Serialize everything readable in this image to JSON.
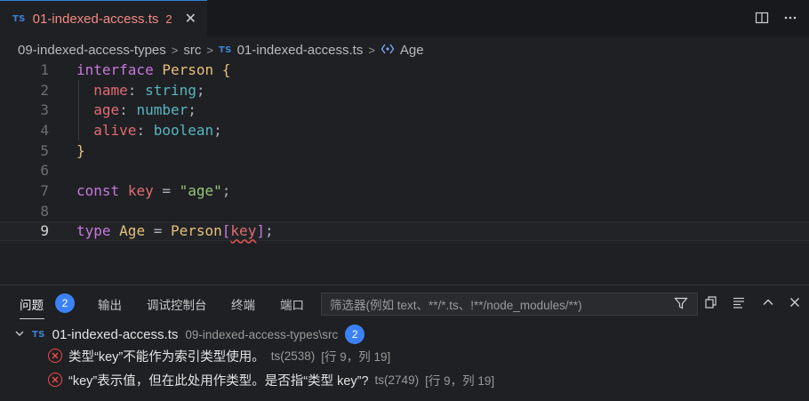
{
  "tab": {
    "lang_badge": "TS",
    "title": "01-indexed-access.ts",
    "problem_count": "2",
    "close_glyph": "✕"
  },
  "tab_actions": {
    "split_icon": "split-editor-icon",
    "more_icon": "more-actions-icon"
  },
  "breadcrumb": {
    "folder": "09-indexed-access-types",
    "subfolder": "src",
    "file_badge": "TS",
    "file": "01-indexed-access.ts",
    "symbol": "Age",
    "sep": ">"
  },
  "editor": {
    "line_numbers": [
      "1",
      "2",
      "3",
      "4",
      "5",
      "6",
      "7",
      "8",
      "9"
    ],
    "current_line": "9",
    "lines": [
      [
        {
          "t": "interface",
          "c": "kw"
        },
        {
          "t": " "
        },
        {
          "t": "Person",
          "c": "ty"
        },
        {
          "t": " "
        },
        {
          "t": "{",
          "c": "brace"
        }
      ],
      [
        {
          "t": "  "
        },
        {
          "t": "name",
          "c": "prop"
        },
        {
          "t": ": ",
          "c": "punc"
        },
        {
          "t": "string",
          "c": "tstr"
        },
        {
          "t": ";",
          "c": "punc"
        }
      ],
      [
        {
          "t": "  "
        },
        {
          "t": "age",
          "c": "prop"
        },
        {
          "t": ": ",
          "c": "punc"
        },
        {
          "t": "number",
          "c": "tstr"
        },
        {
          "t": ";",
          "c": "punc"
        }
      ],
      [
        {
          "t": "  "
        },
        {
          "t": "alive",
          "c": "prop"
        },
        {
          "t": ": ",
          "c": "punc"
        },
        {
          "t": "boolean",
          "c": "tstr"
        },
        {
          "t": ";",
          "c": "punc"
        }
      ],
      [
        {
          "t": "}",
          "c": "brace"
        }
      ],
      [],
      [
        {
          "t": "const",
          "c": "kw"
        },
        {
          "t": " "
        },
        {
          "t": "key",
          "c": "prop"
        },
        {
          "t": " = ",
          "c": "punc"
        },
        {
          "t": "\"age\"",
          "c": "str"
        },
        {
          "t": ";",
          "c": "punc"
        }
      ],
      [],
      [
        {
          "t": "type",
          "c": "kw"
        },
        {
          "t": " "
        },
        {
          "t": "Age",
          "c": "ty"
        },
        {
          "t": " = ",
          "c": "punc"
        },
        {
          "t": "Person",
          "c": "ty"
        },
        {
          "t": "[",
          "c": "brk"
        },
        {
          "t": "key",
          "c": "prop squig"
        },
        {
          "t": "]",
          "c": "brk"
        },
        {
          "t": ";",
          "c": "punc"
        }
      ]
    ]
  },
  "panel": {
    "tabs": {
      "problems": "问题",
      "problems_count": "2",
      "output": "输出",
      "debug_console": "调试控制台",
      "terminal": "终端",
      "ports": "端口"
    },
    "filter_placeholder": "筛选器(例如 text、**/*.ts、!**/node_modules/**)",
    "group": {
      "lang_badge": "TS",
      "file": "01-indexed-access.ts",
      "path": "09-indexed-access-types\\src",
      "count": "2"
    },
    "problems": [
      {
        "message": "类型“key”不能作为索引类型使用。",
        "source": "ts(2538)",
        "location": "[行 9，列 19]"
      },
      {
        "message": "“key”表示值，但在此处用作类型。是否指“类型 key”?",
        "source": "ts(2749)",
        "location": "[行 9，列 19]"
      }
    ]
  },
  "colors": {
    "accent": "#3b82f6",
    "error": "#f14c4c",
    "tab_title": "#f28b82"
  }
}
